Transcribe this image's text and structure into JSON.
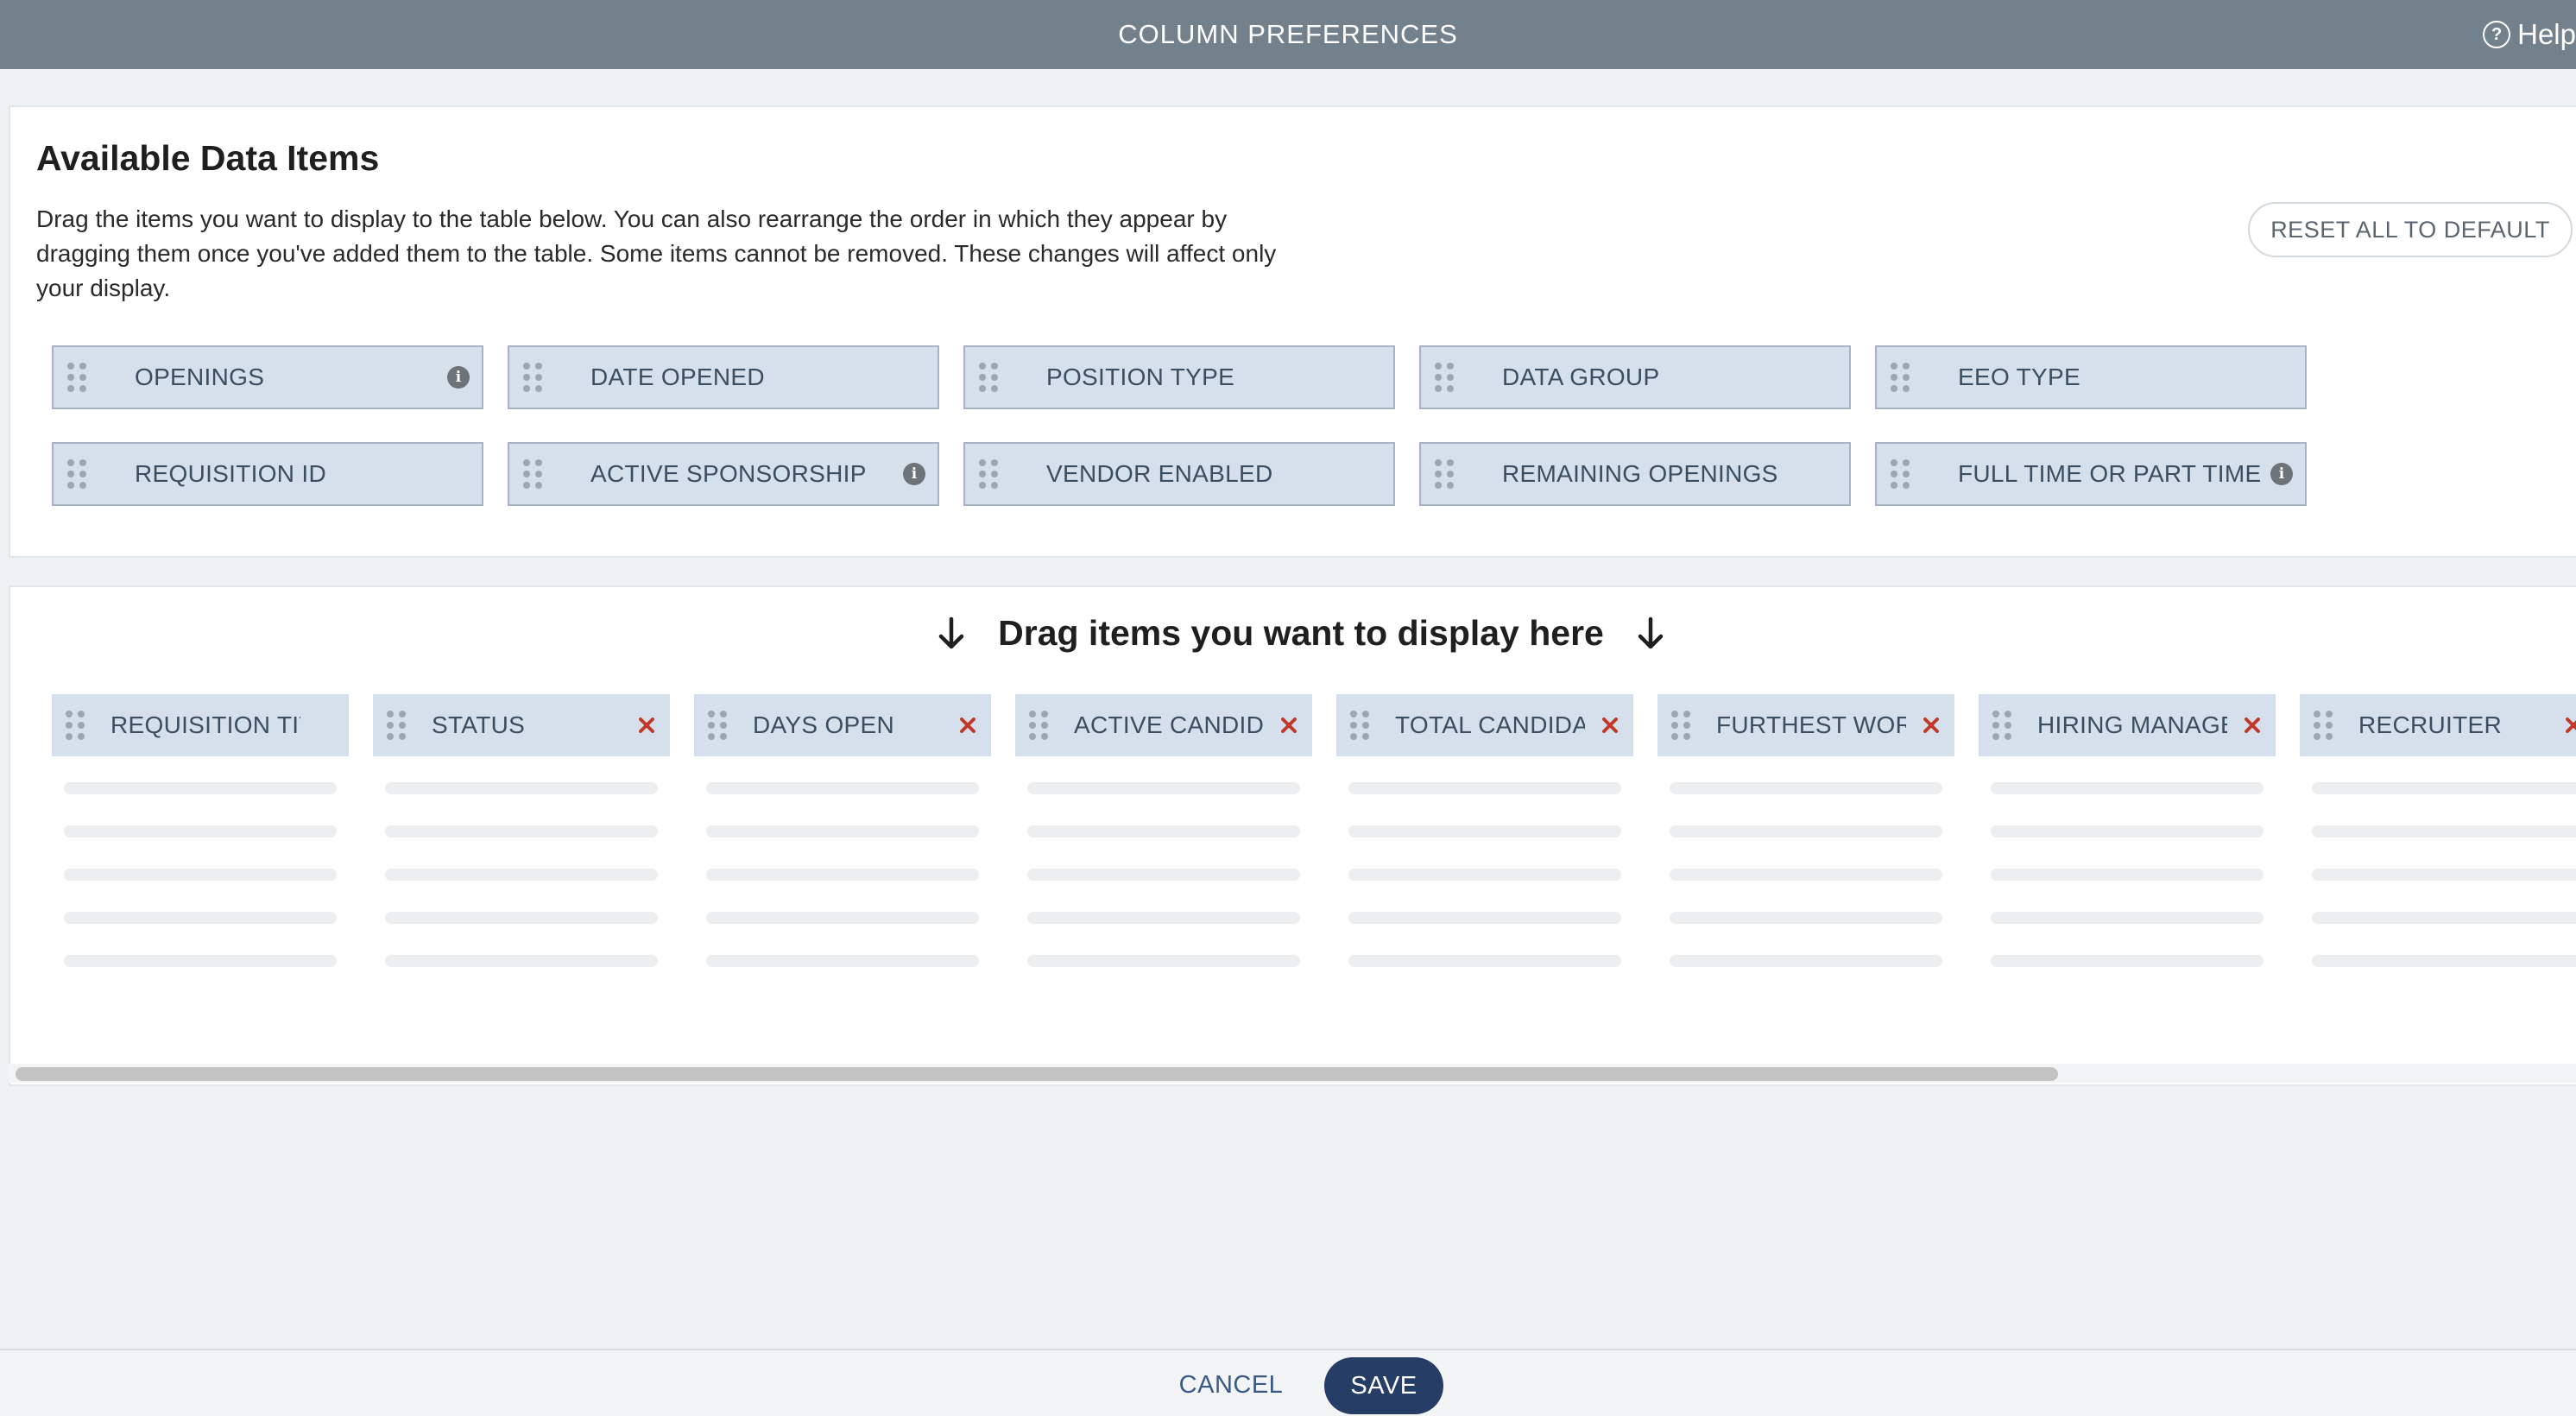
{
  "header": {
    "title": "COLUMN PREFERENCES",
    "help_label": "Help",
    "help_icon": "question-circle-icon"
  },
  "available": {
    "title": "Available Data Items",
    "description": "Drag the items you want to display to the table below. You can also rearrange the order in which they appear by dragging them once you've added them to the table. Some items cannot be removed. These changes will affect only your display.",
    "reset_label": "RESET ALL TO DEFAULT",
    "items": [
      {
        "label": "OPENINGS",
        "info": true
      },
      {
        "label": "DATE OPENED",
        "info": false
      },
      {
        "label": "POSITION TYPE",
        "info": false
      },
      {
        "label": "DATA GROUP",
        "info": false
      },
      {
        "label": "EEO TYPE",
        "info": false
      },
      {
        "label": "REQUISITION ID",
        "info": false
      },
      {
        "label": "ACTIVE SPONSORSHIP",
        "info": true
      },
      {
        "label": "VENDOR ENABLED",
        "info": false
      },
      {
        "label": "REMAINING OPENINGS",
        "info": false
      },
      {
        "label": "FULL TIME OR PART TIME",
        "info": true
      }
    ]
  },
  "display": {
    "hint": "Drag items you want to display here",
    "columns": [
      {
        "label": "REQUISITION TITLE",
        "removable": false
      },
      {
        "label": "STATUS",
        "removable": true
      },
      {
        "label": "DAYS OPEN",
        "removable": true
      },
      {
        "label": "ACTIVE CANDIDATES",
        "removable": true
      },
      {
        "label": "TOTAL CANDIDATES",
        "removable": true
      },
      {
        "label": "FURTHEST WORKFLOW",
        "removable": true
      },
      {
        "label": "HIRING MANAGER",
        "removable": true
      },
      {
        "label": "RECRUITER",
        "removable": true
      }
    ]
  },
  "footer": {
    "cancel_label": "CANCEL",
    "save_label": "SAVE"
  },
  "colors": {
    "header_bg": "#73818d",
    "chip_bg": "#d6e0ec",
    "remove_red": "#c0392b",
    "save_bg": "#263d66"
  }
}
